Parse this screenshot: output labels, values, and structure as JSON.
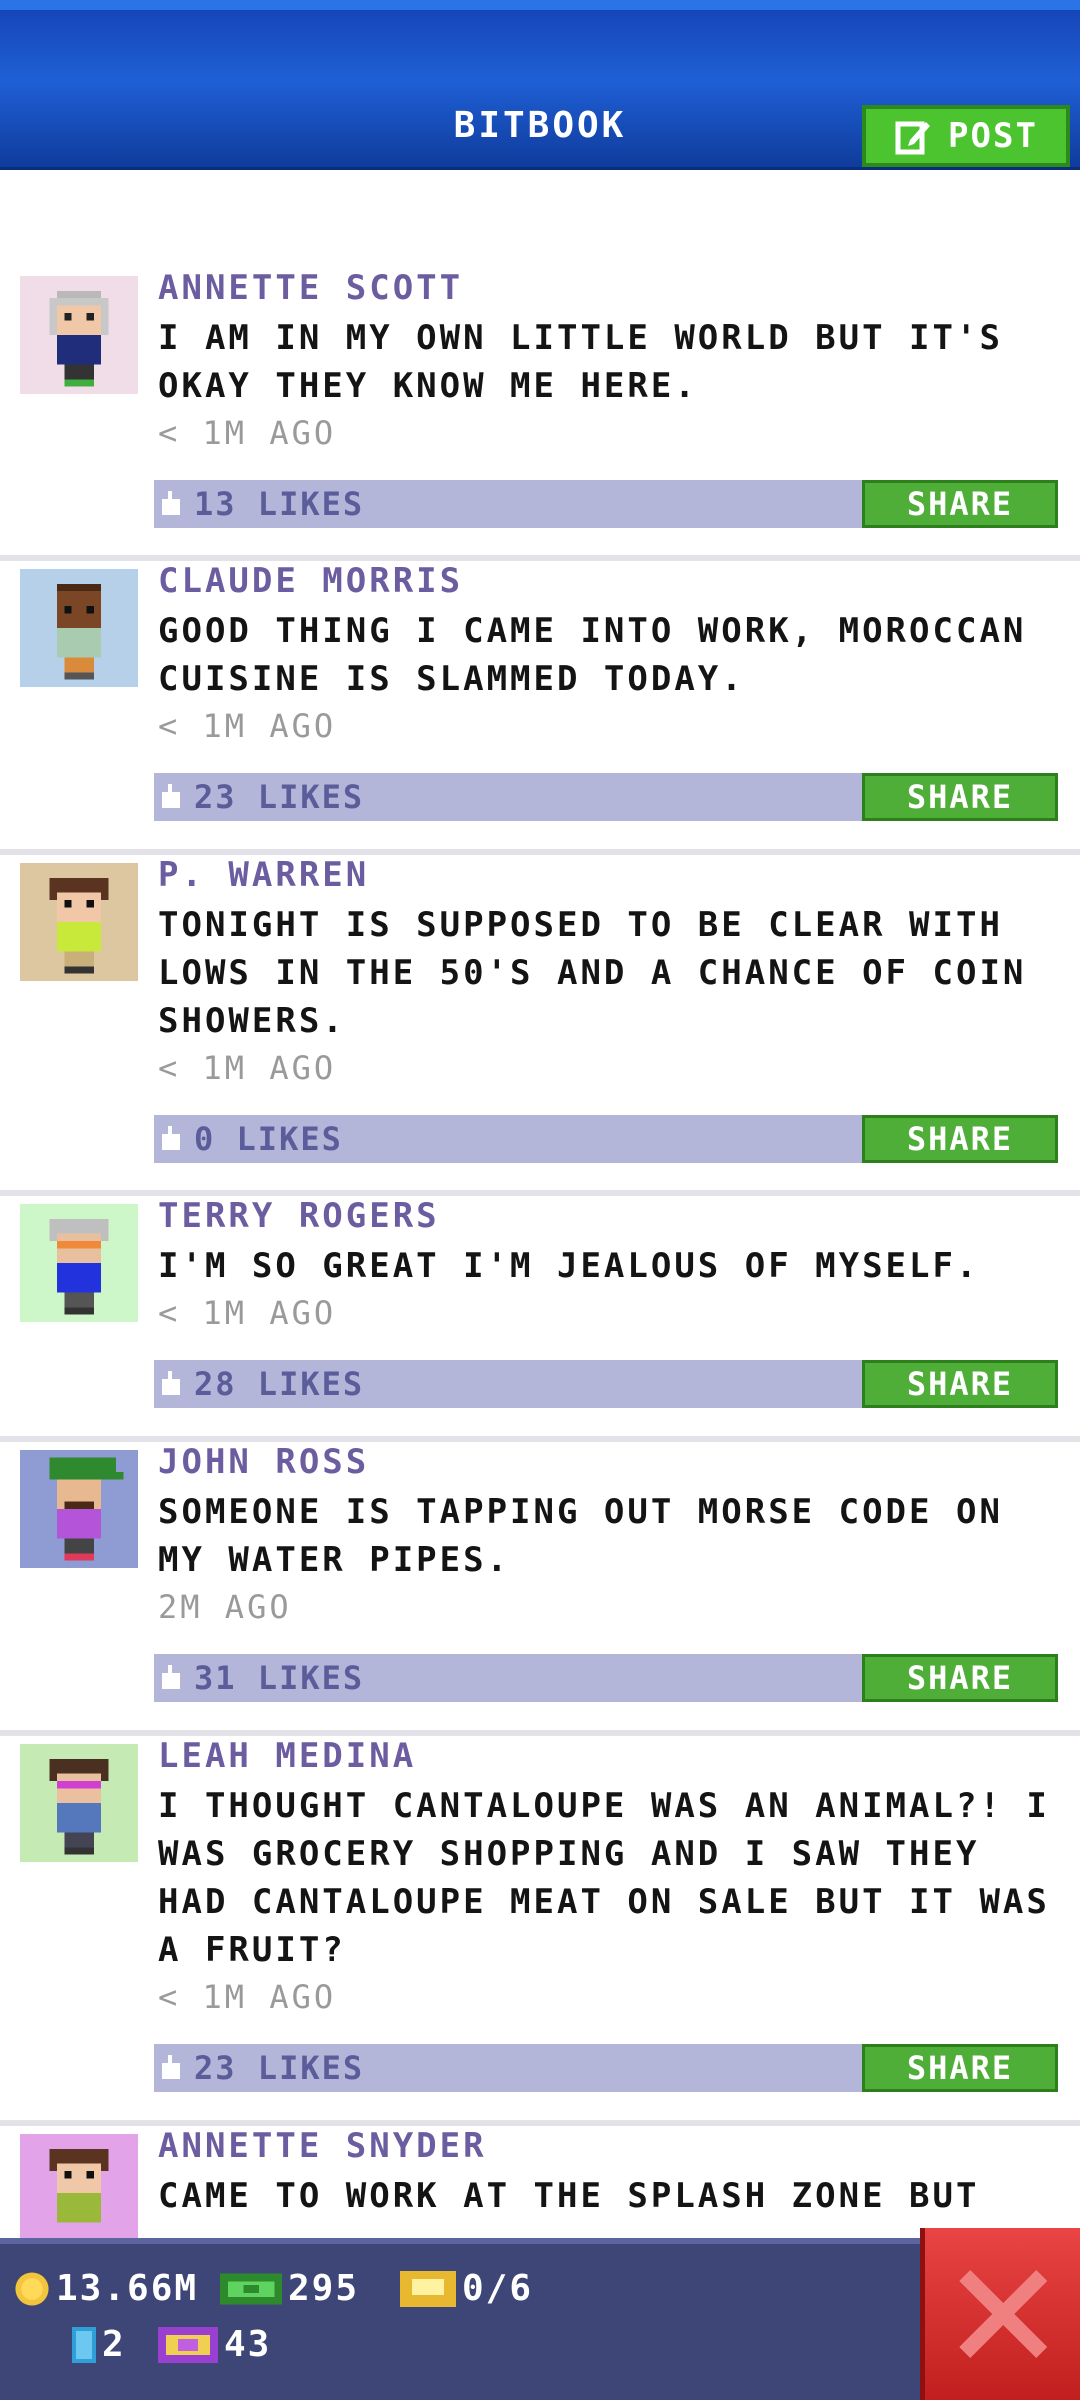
{
  "header": {
    "title": "BITBOOK",
    "post_label": "POST"
  },
  "posts": [
    {
      "name": "ANNETTE SCOTT",
      "lines": [
        "I AM IN MY OWN LITTLE WORLD BUT IT'S",
        "OKAY THEY KNOW ME HERE."
      ],
      "time": "< 1M AGO",
      "likes": "13 LIKES",
      "share": "SHARE"
    },
    {
      "name": "CLAUDE MORRIS",
      "lines": [
        "GOOD THING I CAME INTO WORK, MOROCCAN",
        "CUISINE IS SLAMMED TODAY."
      ],
      "time": "< 1M AGO",
      "likes": "23 LIKES",
      "share": "SHARE"
    },
    {
      "name": "P. WARREN",
      "lines": [
        "TONIGHT IS SUPPOSED TO BE CLEAR WITH",
        "LOWS IN THE 50'S AND A CHANCE OF COIN",
        "SHOWERS."
      ],
      "time": "< 1M AGO",
      "likes": "0 LIKES",
      "share": "SHARE"
    },
    {
      "name": "TERRY ROGERS",
      "lines": [
        "I'M SO GREAT I'M JEALOUS OF MYSELF."
      ],
      "time": "< 1M AGO",
      "likes": "28 LIKES",
      "share": "SHARE"
    },
    {
      "name": "JOHN ROSS",
      "lines": [
        "SOMEONE IS TAPPING OUT MORSE CODE ON",
        "MY WATER PIPES."
      ],
      "time": "2M AGO",
      "likes": "31 LIKES",
      "share": "SHARE"
    },
    {
      "name": "LEAH MEDINA",
      "lines": [
        "I THOUGHT CANTALOUPE WAS AN ANIMAL?! I",
        "WAS GROCERY SHOPPING AND I SAW THEY",
        "HAD CANTALOUPE MEAT ON SALE BUT IT WAS",
        "A FRUIT?"
      ],
      "time": "< 1M AGO",
      "likes": "23 LIKES",
      "share": "SHARE"
    },
    {
      "name": "ANNETTE SNYDER",
      "lines": [
        "CAME TO WORK AT THE SPLASH ZONE BUT"
      ],
      "time": "",
      "likes": "",
      "share": ""
    }
  ],
  "bottom": {
    "coins": "13.66M",
    "bux": "295",
    "tickets": "0/6",
    "elevators": "2",
    "vip": "43"
  },
  "colors": {
    "header": "#1f5fd6",
    "share": "#4fae38",
    "likebar": "#b3b6d8",
    "bottombar": "#3e4678",
    "close": "#e03333"
  }
}
